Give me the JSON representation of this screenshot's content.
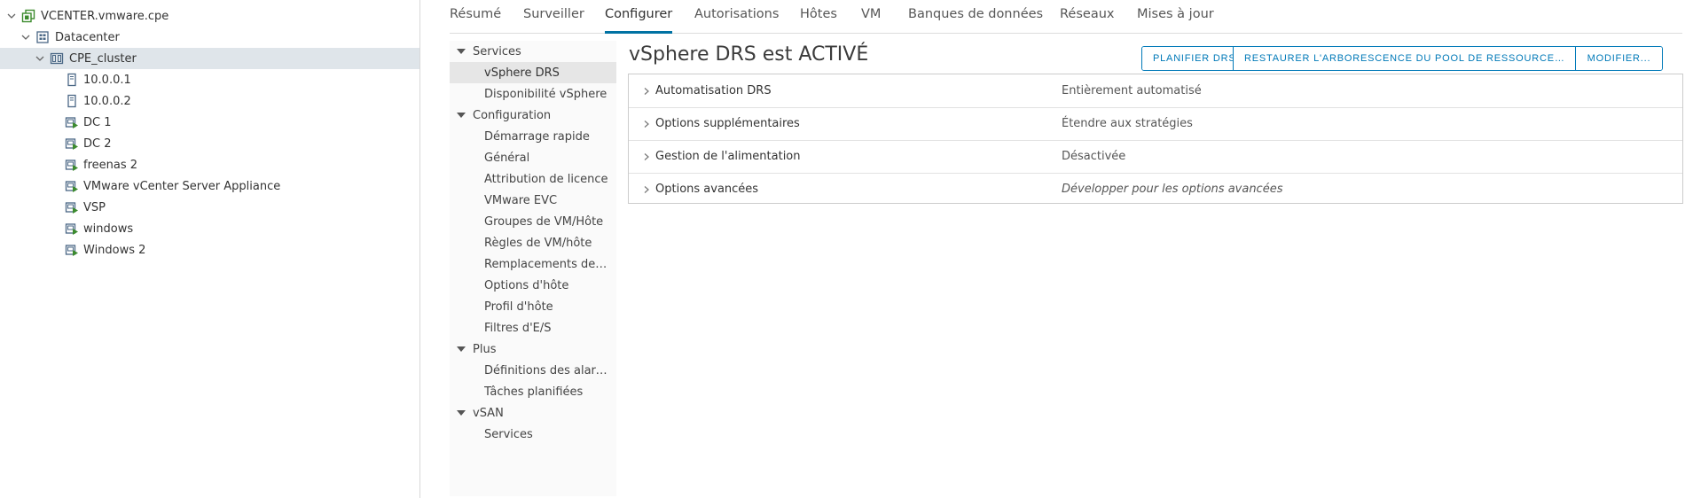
{
  "tree": {
    "nodes": [
      {
        "label": "VCENTER.vmware.cpe",
        "icon": "vcenter-icon"
      },
      {
        "label": "Datacenter",
        "icon": "datacenter-icon"
      },
      {
        "label": "CPE_cluster",
        "icon": "cluster-icon"
      },
      {
        "label": "10.0.0.1",
        "icon": "host-icon"
      },
      {
        "label": "10.0.0.2",
        "icon": "host-icon"
      },
      {
        "label": "DC 1",
        "icon": "vm-icon"
      },
      {
        "label": "DC 2",
        "icon": "vm-icon"
      },
      {
        "label": "freenas 2",
        "icon": "vm-icon"
      },
      {
        "label": "VMware vCenter Server Appliance",
        "icon": "vm-icon"
      },
      {
        "label": "VSP",
        "icon": "vm-icon"
      },
      {
        "label": "windows",
        "icon": "vm-icon"
      },
      {
        "label": "Windows 2",
        "icon": "vm-icon"
      }
    ]
  },
  "tabs": [
    "Résumé",
    "Surveiller",
    "Configurer",
    "Autorisations",
    "Hôtes",
    "VM",
    "Banques de données",
    "Réseaux",
    "Mises à jour"
  ],
  "active_tab": "Configurer",
  "nav": {
    "groups": [
      {
        "label": "Services",
        "items": [
          "vSphere DRS",
          "Disponibilité vSphere"
        ]
      },
      {
        "label": "Configuration",
        "items": [
          "Démarrage rapide",
          "Général",
          "Attribution de licence",
          "VMware EVC",
          "Groupes de VM/Hôte",
          "Règles de VM/hôte",
          "Remplacements de VM",
          "Options d'hôte",
          "Profil d'hôte",
          "Filtres d'E/S"
        ]
      },
      {
        "label": "Plus",
        "items": [
          "Définitions des alarmes",
          "Tâches planifiées"
        ]
      },
      {
        "label": "vSAN",
        "items": [
          "Services"
        ]
      }
    ],
    "selected": "vSphere DRS"
  },
  "main": {
    "title": "vSphere DRS est ACTIVÉ",
    "buttons": {
      "plan": "PLANIFIER DRS...",
      "restore": "RESTAURER L'ARBORESCENCE DU POOL DE RESSOURCES...",
      "edit": "MODIFIER..."
    },
    "rows": [
      {
        "key": "Automatisation DRS",
        "value": "Entièrement automatisé"
      },
      {
        "key": "Options supplémentaires",
        "value": "Étendre aux stratégies"
      },
      {
        "key": "Gestion de l'alimentation",
        "value": "Désactivée"
      },
      {
        "key": "Options avancées",
        "value": "Développer pour les options avancées"
      }
    ]
  },
  "colors": {
    "accent": "#0079b8",
    "tab_underline": "#0072a3",
    "selected_tree_row": "#dfe5ea",
    "vm_icon_green": "#3c8b2e"
  }
}
